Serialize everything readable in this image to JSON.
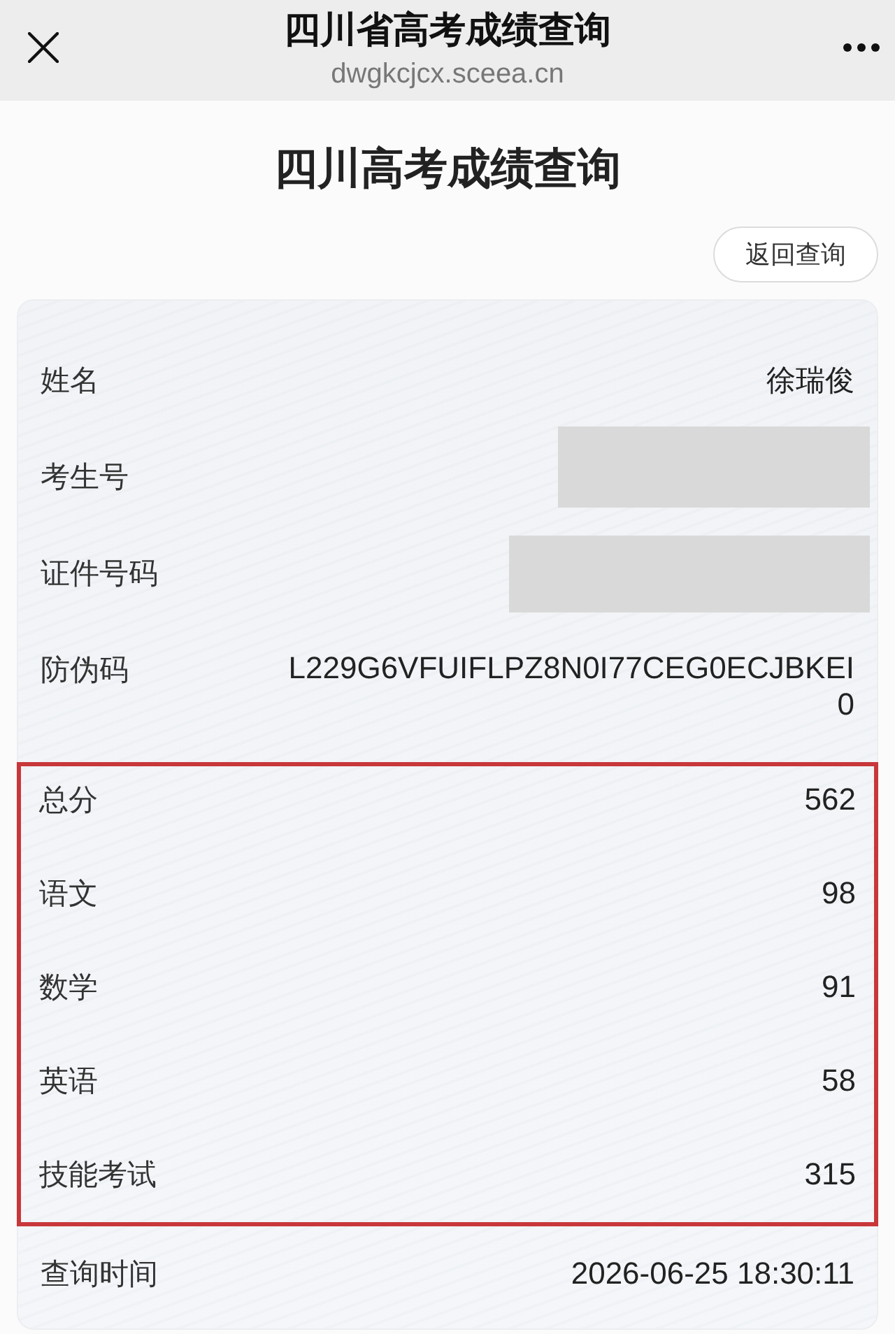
{
  "nav_bar": {
    "title": "四川省高考成绩查询",
    "url": "dwgkcjcx.sceea.cn"
  },
  "page": {
    "title": "四川高考成绩查询",
    "back_button": "返回查询"
  },
  "info_rows": [
    {
      "label": "姓名",
      "value": "徐瑞俊"
    },
    {
      "label": "考生号",
      "redacted": true
    },
    {
      "label": "证件号码",
      "redacted": true
    },
    {
      "label": "防伪码",
      "value": "L229G6VFUIFLPZ8N0I77CEG0ECJBKEI0"
    }
  ],
  "scores": {
    "highlighted": true,
    "rows": [
      {
        "label": "总分",
        "value": "562"
      },
      {
        "label": "语文",
        "value": "98"
      },
      {
        "label": "数学",
        "value": "91"
      },
      {
        "label": "英语",
        "value": "58"
      },
      {
        "label": "技能考试",
        "value": "315"
      }
    ]
  },
  "query_time": {
    "label": "查询时间",
    "value": "2026-06-25 18:30:11"
  }
}
